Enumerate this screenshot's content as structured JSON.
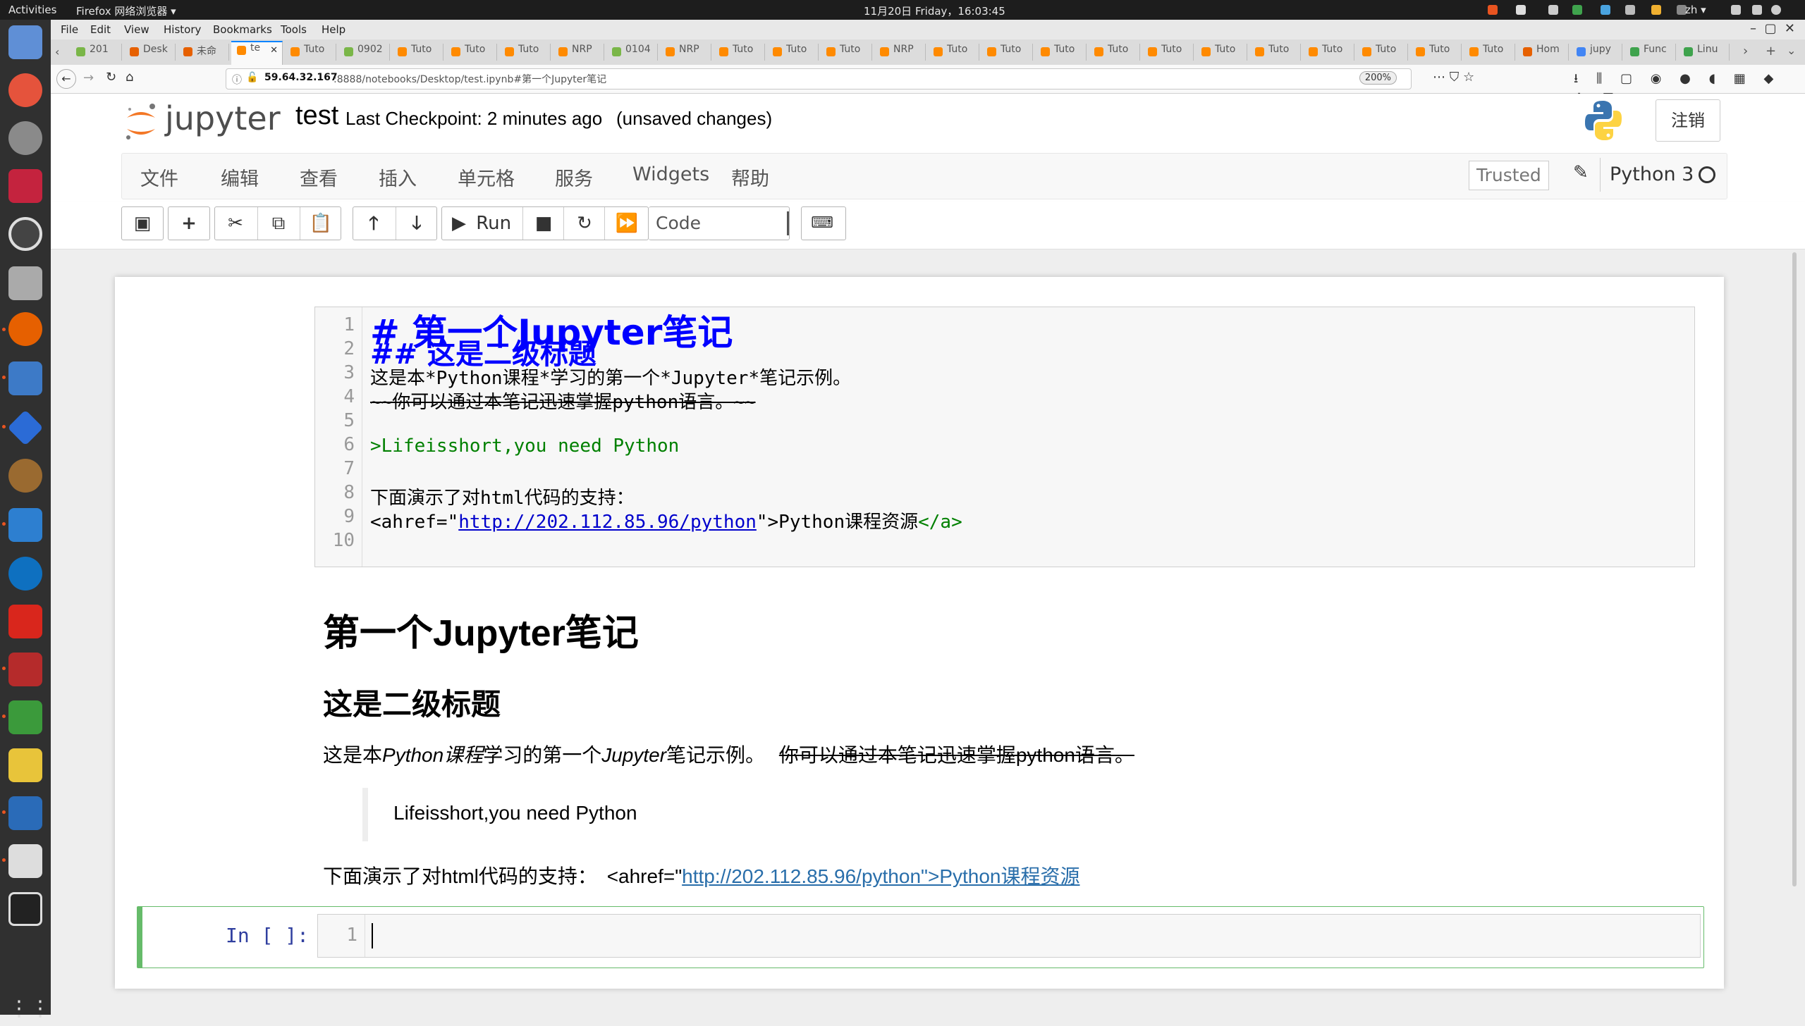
{
  "os": {
    "activities": "Activities",
    "app_title": "Firefox 网络浏览器 ▾",
    "clock": "11月20日 Friday，16:03:45",
    "lang": "zh ▾"
  },
  "browser": {
    "menu": [
      "File",
      "Edit",
      "View",
      "History",
      "Bookmarks",
      "Tools",
      "Help"
    ],
    "tabs": [
      "201",
      "Desk",
      "未命",
      "te",
      "Tuto",
      "0902",
      "Tuto",
      "Tuto",
      "Tuto",
      "NRP",
      "0104",
      "NRP",
      "Tuto",
      "Tuto",
      "Tuto",
      "NRP",
      "Tuto",
      "Tuto",
      "Tuto",
      "Tuto",
      "Tuto",
      "Tuto",
      "Tuto",
      "Tuto",
      "Tuto",
      "Tuto",
      "Tuto",
      "Hom",
      "jupy",
      "Func",
      "Linu"
    ],
    "url_host": "59.64.32.167",
    "url_rest": ":8888/notebooks/Desktop/test.ipynb#第一个Jupyter笔记",
    "zoom": "200%"
  },
  "jupyter": {
    "logo_text": "jupyter",
    "notebook_name": "test",
    "checkpoint": "Last Checkpoint: 2 minutes ago",
    "unsaved": "(unsaved changes)",
    "logout": "注销",
    "menu": [
      "文件",
      "编辑",
      "查看",
      "插入",
      "单元格",
      "服务",
      "Widgets",
      "帮助"
    ],
    "trusted": "Trusted",
    "kernel": "Python 3",
    "run_label": "Run",
    "cell_type": "Code"
  },
  "markdown_source": {
    "line_numbers": [
      "1",
      "2",
      "3",
      "4",
      "5",
      "6",
      "7",
      "8",
      "9",
      "10"
    ],
    "l1": "# 第一个Jupyter笔记",
    "l2": "## 这是二级标题",
    "l3": "这是本*Python课程*学习的第一个*Jupyter*笔记示例。",
    "l4": "~~你可以通过本笔记迅速掌握python语言。~~",
    "l6": ">Lifeisshort,you need Python",
    "l8": "下面演示了对html代码的支持：",
    "l9a": "<ahref=\"",
    "l9b": "http://202.112.85.96/python",
    "l9c": "\">Python课程资源",
    "l9d": "</a>"
  },
  "rendered": {
    "h1": "第一个Jupyter笔记",
    "h2": "这是二级标题",
    "p1a": "这是本",
    "p1b": "Python课程",
    "p1c": "学习的第一个",
    "p1d": "Jupyter",
    "p1e": "笔记示例。",
    "p1f": "你可以通过本笔记迅速掌握python语言。",
    "quote": "Lifeisshort,you need Python",
    "p2a": "下面演示了对html代码的支持：",
    "p2b": "<ahref=\"",
    "p2c": "http://202.112.85.96/python\">Python课程资源"
  },
  "code_cell": {
    "prompt": "In [ ]:",
    "line": "1"
  },
  "colors": {
    "heading_md": "#0000ff",
    "quote_md": "#008000",
    "link": "#296eaa",
    "selected_cell": "#66bb6a"
  }
}
